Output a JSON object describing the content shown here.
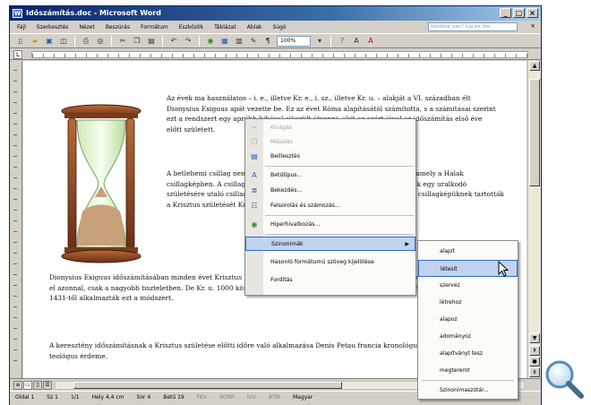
{
  "window": {
    "title": "Időszámítás.doc - Microsoft Word",
    "app_icon": "W",
    "buttons": {
      "minimize": "_",
      "maximize": "□",
      "close": "×"
    }
  },
  "menubar": {
    "items": [
      "Fájl",
      "Szerkesztés",
      "Nézet",
      "Beszúrás",
      "Formátum",
      "Eszközök",
      "Táblázat",
      "Ablak",
      "Súgó"
    ],
    "help_placeholder": "Kérdése van? Írja be ide.",
    "close_doc": "×"
  },
  "toolbar": {
    "icons": [
      "new-icon",
      "open-icon",
      "save-icon",
      "permission-icon",
      "print-icon",
      "print-preview-icon",
      "cut-icon",
      "copy-icon",
      "paste-icon",
      "undo-icon",
      "redo-icon",
      "hyperlink-icon",
      "table-icon",
      "columns-icon",
      "drawing-icon",
      "show-marks-icon",
      "zoom-select",
      "help-icon",
      "font-icon",
      "highlight-icon",
      "font-color-icon"
    ],
    "zoom": "100%"
  },
  "document": {
    "p1": "Az évek ma használatos – i. e., illetve Kr. e., i. sz., illetve Kr. u. – alakját a VI. században élt Dionysius Exiguus apát vezette be. Ez az évet Róma alapításától számította, s a számításai szerint ezt a rendszert egy apróbb hibával sikerült átvenni, akit az ezért jóval az időszámítás első éve előtt született.",
    "p2": "A betlehemi csillag nem más, mint a Szaturnusz és a Jupiter együttállása, amely a Halak csillagképben. A csillag a Kr. e. 7. esztendőben volt látható, a keleti bölcsek egy uralkodó születésére utaló csillagászati eseményt, mivel a Szaturnusz a Jupiter és a csillagképüknek tartották a Krisztus születését Kr. e. 7-ben született.",
    "p3": "Dionysius Exiguus időszámításában minden évet Krisztus születésétől számított. A keresztény időszámítási rendszer azonban nem terjedt el azonnal, csak a nagyobb tiszteletben. De Kr. u. 1000 körül már mindenütt Jézus születésétől számolták az éveket, bár a pápák csak 1431-től alkalmazták ezt a módszert.",
    "p4": "A keresztény időszámításnak a Krisztus születése előtti időre való alkalmazása Denis Petau francia kronológus, filológus és katolikus teológus érdeme."
  },
  "context_menu": {
    "items": [
      {
        "label": "Kivágás",
        "icon": "cut-icon",
        "disabled": true
      },
      {
        "label": "Másolás",
        "icon": "copy-icon",
        "disabled": true
      },
      {
        "label": "Beillesztés",
        "icon": "paste-icon",
        "disabled": false
      },
      {
        "label": "Betűtípus...",
        "icon": "font-icon",
        "disabled": false
      },
      {
        "label": "Bekezdés...",
        "icon": "paragraph-icon",
        "disabled": false
      },
      {
        "label": "Felsorolás és számozás...",
        "icon": "bullets-icon",
        "disabled": false
      },
      {
        "label": "Hiperhivatkozás...",
        "icon": "hyperlink-icon",
        "disabled": false
      },
      {
        "label": "Szinonimák",
        "icon": "",
        "disabled": false,
        "submenu": true
      },
      {
        "label": "Hasonló formátumú szöveg kijelölése",
        "icon": "",
        "disabled": false
      },
      {
        "label": "Fordítás",
        "icon": "",
        "disabled": false
      }
    ]
  },
  "synonym_menu": {
    "items": [
      "alapít",
      "létesít",
      "szervez",
      "létrehoz",
      "alapoz",
      "adományoz",
      "alapítványt tesz",
      "megteremt"
    ],
    "footer": "Szinonimaszótár..."
  },
  "statusbar": {
    "page": "Oldal 1",
    "section": "Sz 1",
    "pages": "1/1",
    "position": "Hely 4,4 cm",
    "line": "Sor 4",
    "column": "Betű 19",
    "rec": "FKV",
    "trk": "KORR",
    "ext": "KIV",
    "ovr": "ÁTÍR",
    "language": "Magyar"
  }
}
